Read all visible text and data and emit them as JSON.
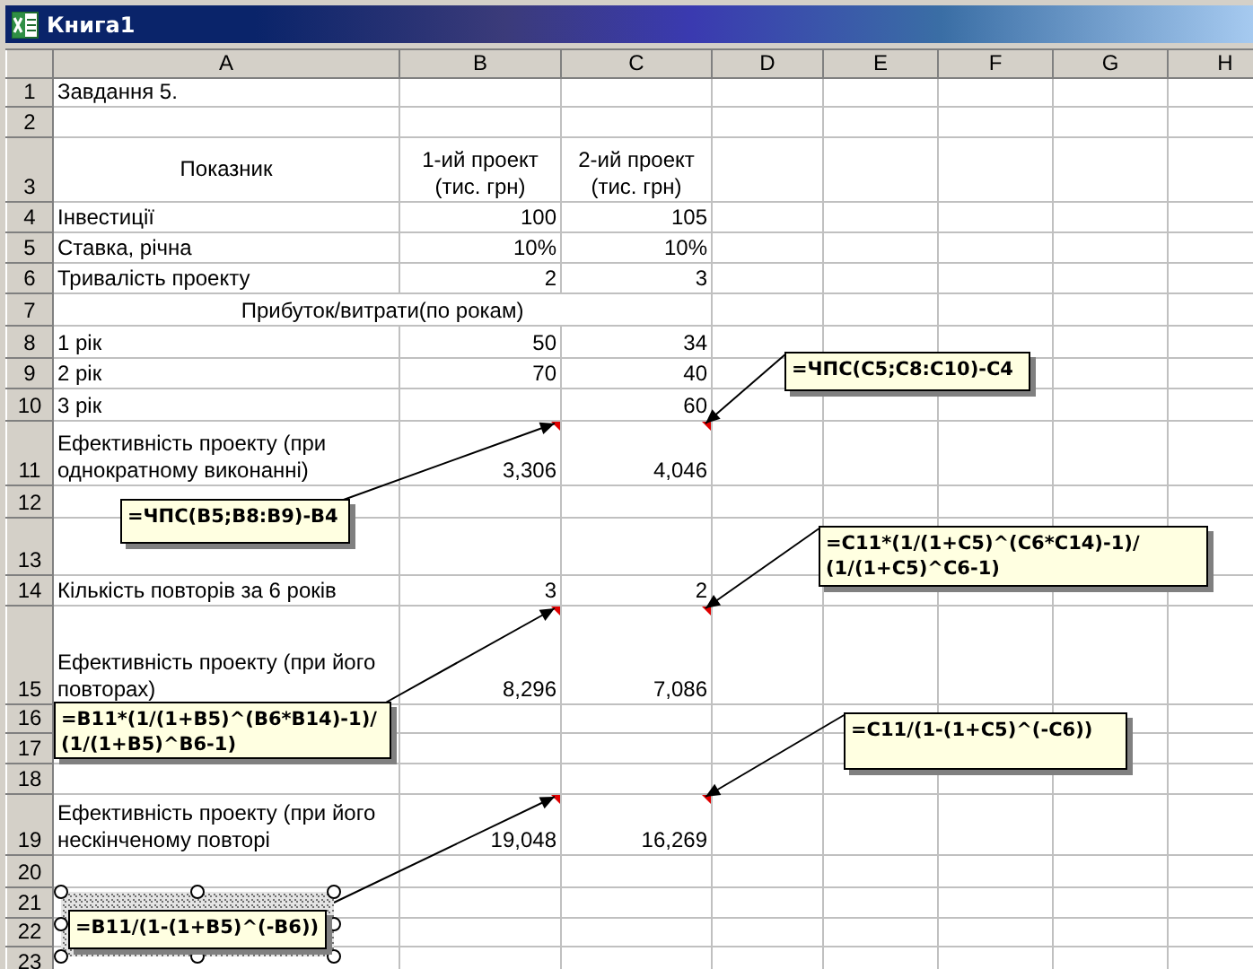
{
  "window": {
    "title": "Книга1"
  },
  "columns": [
    "A",
    "B",
    "C",
    "D",
    "E",
    "F",
    "G",
    "H"
  ],
  "rows": [
    {
      "number": "1",
      "kind": "normal",
      "a": "Завдання 5."
    },
    {
      "number": "2",
      "kind": "normal"
    },
    {
      "number": "3",
      "kind": "header",
      "a": "Показник",
      "b": "1-ий проект\n(тис. грн)",
      "c": "2-ий проект\n(тис. грн)"
    },
    {
      "number": "4",
      "kind": "normal",
      "a": "Інвестиції",
      "b": "100",
      "c": "105"
    },
    {
      "number": "5",
      "kind": "normal",
      "a": "Ставка, річна",
      "b": "10%",
      "c": "10%"
    },
    {
      "number": "6",
      "kind": "normal",
      "a": "Тривалість проекту",
      "b": "2",
      "c": "3"
    },
    {
      "number": "7",
      "kind": "span",
      "a": "Прибуток/витрати(по рокам)"
    },
    {
      "number": "8",
      "kind": "normal",
      "a": "1 рік",
      "b": "50",
      "c": "34"
    },
    {
      "number": "9",
      "kind": "normal",
      "a": "2 рік",
      "b": "70",
      "c": "40"
    },
    {
      "number": "10",
      "kind": "normal",
      "a": "3 рік",
      "c": "60"
    },
    {
      "number": "11",
      "kind": "normal",
      "a": "Ефективність проекту (при\nоднократному виконанні)",
      "b": "3,306",
      "c": "4,046",
      "b_comment": {
        "text": "=ЧПС(B5;B8:B9)-B4",
        "selected": false
      },
      "c_comment": {
        "text": "=ЧПС(C5;C8:C10)-C4",
        "selected": false
      }
    },
    {
      "number": "12",
      "kind": "normal"
    },
    {
      "number": "13",
      "kind": "normal"
    },
    {
      "number": "14",
      "kind": "normal",
      "a": "Кількість повторів за 6 років",
      "b": "3",
      "c": "2"
    },
    {
      "number": "15",
      "kind": "normal",
      "a": "Ефективність проекту (при його\nповторах)",
      "b": "8,296",
      "c": "7,086",
      "b_comment": {
        "text": "=B11*(1/(1+B5)^(B6*B14)-1)/\n(1/(1+B5)^B6-1)",
        "selected": false
      },
      "c_comment": {
        "text": "=C11*(1/(1+C5)^(C6*C14)-1)/\n(1/(1+C5)^C6-1)",
        "selected": false
      }
    },
    {
      "number": "16",
      "kind": "normal"
    },
    {
      "number": "17",
      "kind": "normal"
    },
    {
      "number": "18",
      "kind": "normal"
    },
    {
      "number": "19",
      "kind": "normal",
      "a": "Ефективність проекту (при його\nнескінченому повторі",
      "b": "19,048",
      "c": "16,269",
      "b_comment": {
        "text": "=B11/(1-(1+B5)^(-B6))",
        "selected": true
      },
      "c_comment": {
        "text": "=C11/(1-(1+C5)^(-C6))",
        "selected": false
      }
    },
    {
      "number": "20",
      "kind": "normal"
    },
    {
      "number": "21",
      "kind": "normal"
    },
    {
      "number": "22",
      "kind": "normal"
    },
    {
      "number": "23",
      "kind": "normal"
    }
  ]
}
